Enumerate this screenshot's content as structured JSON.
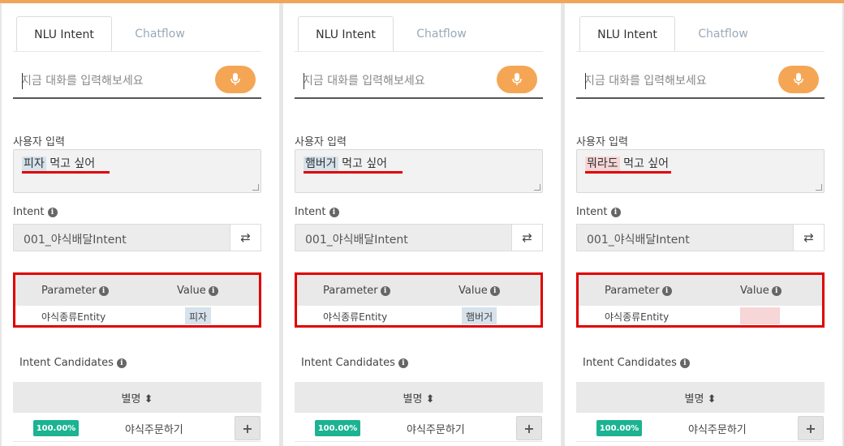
{
  "colors": {
    "accent": "#f5a654",
    "highlight_red": "#e00000",
    "badge_green": "#1bb392"
  },
  "tabs": {
    "active": "NLU Intent",
    "inactive": "Chatflow"
  },
  "chat": {
    "placeholder": "지금 대화를 입력해보세요"
  },
  "labels": {
    "user_input": "사용자 입력",
    "intent": "Intent",
    "parameter": "Parameter",
    "value": "Value",
    "intent_candidates": "Intent Candidates",
    "alias": "별명 ⬍"
  },
  "icons": {
    "mic": "microphone-icon",
    "swap": "swap-icon",
    "info": "info-icon",
    "plus": "plus-icon",
    "sort": "sort-icon"
  },
  "panels": [
    {
      "entity_text": "피자",
      "rest_text": " 먹고 싶어",
      "intent": "001_야식배달Intent",
      "param_name": "야식종류Entity",
      "param_value": "피자",
      "value_state": "matched",
      "candidate": {
        "score": "100.00%",
        "name": "야식주문하기"
      }
    },
    {
      "entity_text": "햄버거",
      "rest_text": " 먹고 싶어",
      "intent": "001_야식배달Intent",
      "param_name": "야식종류Entity",
      "param_value": "햄버거",
      "value_state": "matched",
      "candidate": {
        "score": "100.00%",
        "name": "야식주문하기"
      }
    },
    {
      "entity_text": "뭐라도",
      "rest_text": " 먹고 싶어",
      "intent": "001_야식배달Intent",
      "param_name": "야식종류Entity",
      "param_value": "",
      "value_state": "empty",
      "candidate": {
        "score": "100.00%",
        "name": "야식주문하기"
      }
    }
  ]
}
